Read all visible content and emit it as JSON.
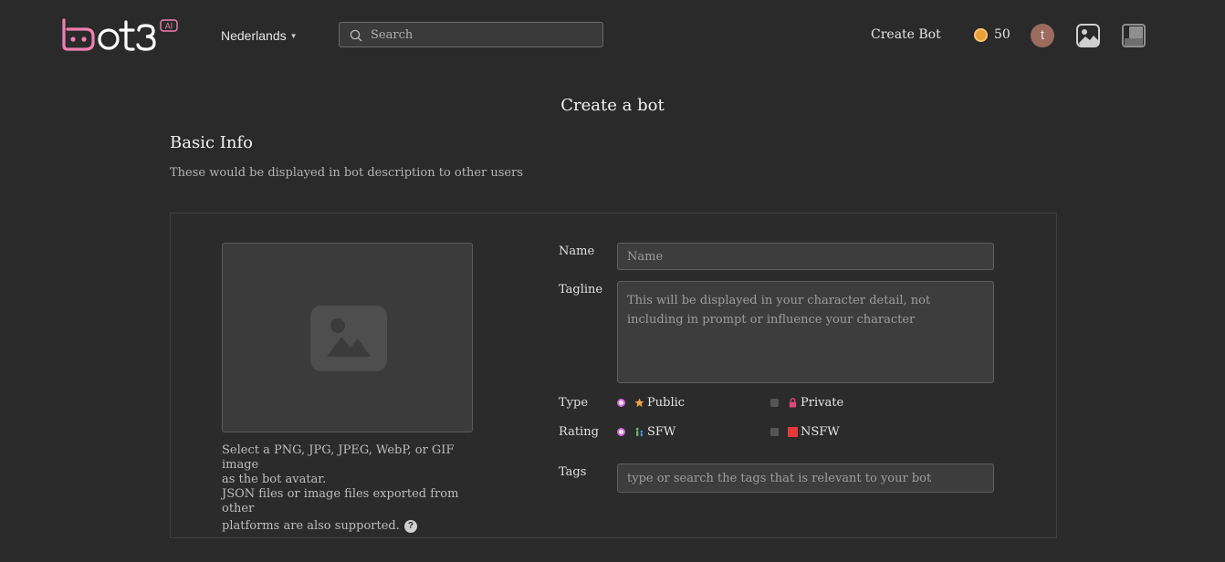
{
  "header": {
    "logo_text": "bot3",
    "logo_badge": "AI",
    "language": "Nederlands",
    "search_placeholder": "Search",
    "create_bot": "Create Bot",
    "coins": "50",
    "avatar_initial": "t"
  },
  "page": {
    "title": "Create a bot",
    "section_title": "Basic Info",
    "section_subtitle": "These would be displayed in bot description to other users"
  },
  "upload": {
    "hint_line1": "Select a PNG, JPG, JPEG, WebP, or GIF image",
    "hint_line2": "as the bot avatar.",
    "hint_line3": "JSON files or image files exported from other",
    "hint_line4": "platforms are also supported."
  },
  "form": {
    "name_label": "Name",
    "name_placeholder": "Name",
    "tagline_label": "Tagline",
    "tagline_placeholder": "This will be displayed in your character detail, not including in prompt or influence your character",
    "type_label": "Type",
    "type_public": "Public",
    "type_private": "Private",
    "rating_label": "Rating",
    "rating_sfw": "SFW",
    "rating_nsfw": "NSFW",
    "tags_label": "Tags",
    "tags_placeholder": "type or search the tags that is relevant to your bot"
  },
  "colors": {
    "background": "#2a2a2a",
    "accent": "#d46ad9",
    "logo_pink": "#f07fb0",
    "coin": "#e9a23b",
    "nsfw_red": "#e33b3b",
    "private_pink": "#e0457b"
  }
}
